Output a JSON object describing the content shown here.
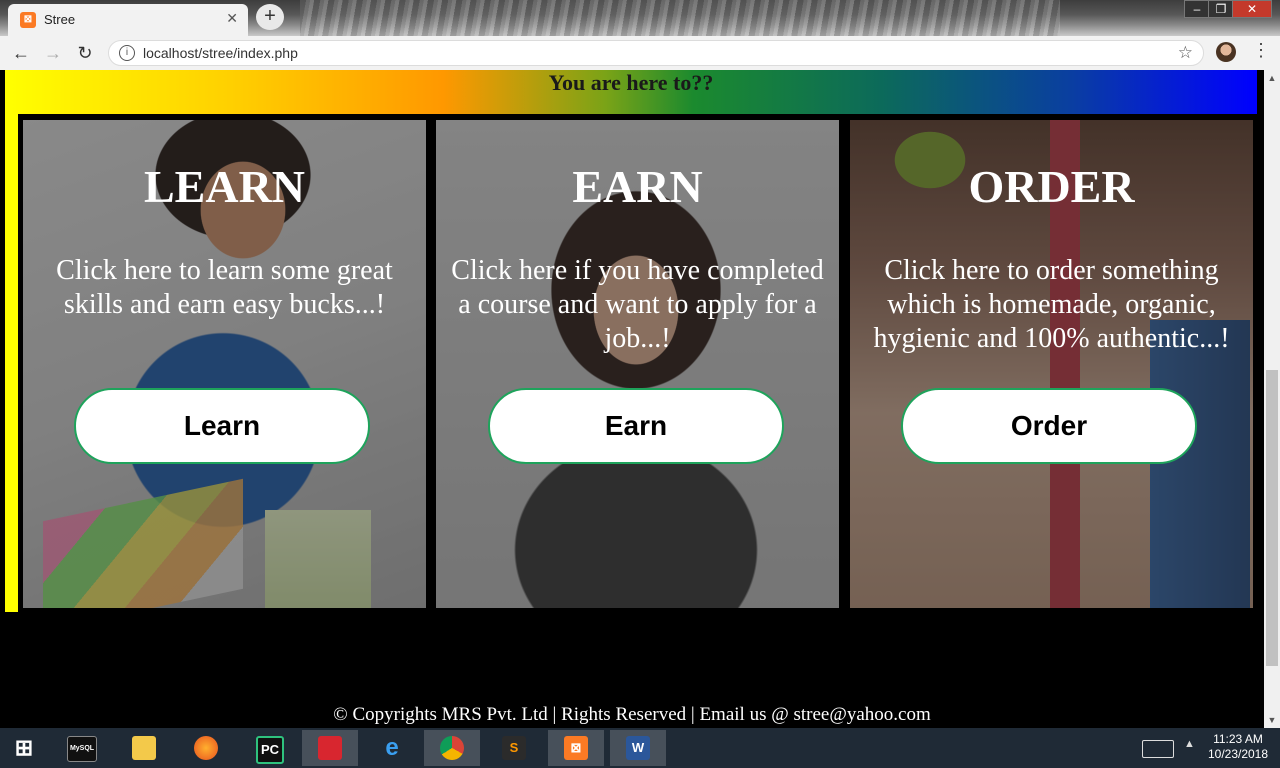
{
  "browser": {
    "tab_title": "Stree",
    "tab_favicon_icon": "xampp-icon",
    "url": "localhost/stree/index.php"
  },
  "page": {
    "banner_text": "You are here to??",
    "cards": [
      {
        "heading": "LEARN",
        "text": "Click here to learn some great skills and earn easy bucks...!",
        "button": "Learn"
      },
      {
        "heading": "EARN",
        "text": "Click here if you have completed a course and want to apply for a job...!",
        "button": "Earn"
      },
      {
        "heading": "ORDER",
        "text": "Click here to order something which is homemade, organic, hygienic and 100% authentic...!",
        "button": "Order"
      }
    ],
    "footer": "© Copyrights MRS Pvt. Ltd | Rights Reserved | Email us @ stree@yahoo.com"
  },
  "taskbar": {
    "apps": [
      {
        "icon": "mysql-icon",
        "label": "MySQL"
      },
      {
        "icon": "file-explorer-icon",
        "label": ""
      },
      {
        "icon": "firefox-icon",
        "label": ""
      },
      {
        "icon": "pycharm-icon",
        "label": "PC"
      },
      {
        "icon": "scratch-icon",
        "label": ""
      },
      {
        "icon": "internet-explorer-icon",
        "label": ""
      },
      {
        "icon": "chrome-icon",
        "label": ""
      },
      {
        "icon": "sublime-text-icon",
        "label": ""
      },
      {
        "icon": "xampp-icon",
        "label": ""
      },
      {
        "icon": "word-icon",
        "label": "W"
      }
    ],
    "time": "11:23 AM",
    "date": "10/23/2018"
  },
  "colors": {
    "button_border": "#1ea35b",
    "banner_start": "#ffff00",
    "banner_end": "#0000ff"
  }
}
